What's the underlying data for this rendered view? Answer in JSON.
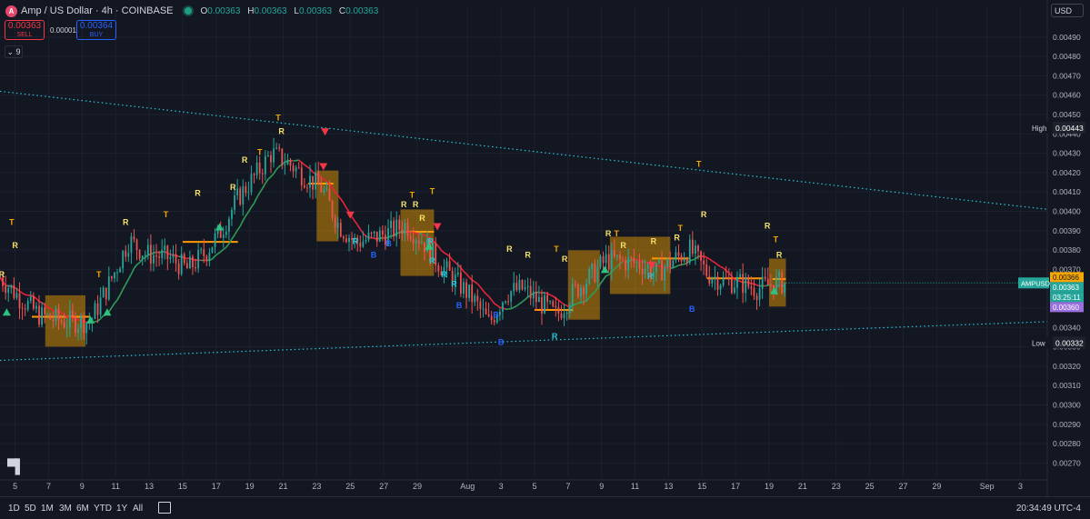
{
  "header": {
    "logo_letter": "A",
    "symbol": "Amp / US Dollar · 4h · COINBASE",
    "ohlc": [
      {
        "label": "O",
        "value": "0.00363"
      },
      {
        "label": "H",
        "value": "0.00363"
      },
      {
        "label": "L",
        "value": "0.00363"
      },
      {
        "label": "C",
        "value": "0.00363"
      }
    ]
  },
  "trade": {
    "sell_price": "0.00363",
    "sell_label": "SELL",
    "spread": "0.00001",
    "buy_price": "0.00364",
    "buy_label": "BUY"
  },
  "indicators_toggle": "9",
  "currency": "USD",
  "timeframes": [
    "1D",
    "5D",
    "1M",
    "3M",
    "6M",
    "YTD",
    "1Y",
    "All"
  ],
  "clock": "20:34:49 UTC-4",
  "chart_data": {
    "type": "candlestick",
    "title": "Amp / US Dollar · 4h · COINBASE",
    "y_ticks": [
      0.0049,
      0.0048,
      0.0047,
      0.0046,
      0.0045,
      0.0044,
      0.0043,
      0.0042,
      0.0041,
      0.004,
      0.0039,
      0.0038,
      0.0037,
      0.0036,
      0.0035,
      0.0034,
      0.0033,
      0.0032,
      0.0031,
      0.003,
      0.0029,
      0.0028,
      0.0027
    ],
    "y_tick_labels": [
      "0.00490",
      "0.00480",
      "0.00470",
      "0.00460",
      "0.00450",
      "0.00440",
      "0.00430",
      "0.00420",
      "0.00410",
      "0.00400",
      "0.00390",
      "0.00380",
      "0.00370",
      "0.00360",
      "0.00350",
      "0.00340",
      "0.00330",
      "0.00320",
      "0.00310",
      "0.00300",
      "0.00290",
      "0.00280",
      "0.00270"
    ],
    "ylim": [
      0.00265,
      0.00496
    ],
    "x_tick_labels": [
      "5",
      "7",
      "9",
      "11",
      "13",
      "15",
      "17",
      "19",
      "21",
      "23",
      "25",
      "27",
      "29",
      "Aug",
      "3",
      "5",
      "7",
      "9",
      "11",
      "13",
      "15",
      "17",
      "19",
      "21",
      "23",
      "25",
      "27",
      "29",
      "Sep",
      "3"
    ],
    "x_tick_days": [
      5,
      7,
      9,
      11,
      13,
      15,
      17,
      19,
      21,
      23,
      25,
      27,
      29,
      32,
      34,
      36,
      38,
      40,
      42,
      44,
      46,
      48,
      50,
      52,
      54,
      56,
      58,
      60,
      63,
      65
    ],
    "xlim_days": [
      4.1,
      66.6
    ],
    "price_path": [
      [
        4.1,
        0.00366
      ],
      [
        5.2,
        0.00356
      ],
      [
        6.5,
        0.00346
      ],
      [
        8.0,
        0.00343
      ],
      [
        9.5,
        0.00343
      ],
      [
        10.8,
        0.00366
      ],
      [
        11.8,
        0.00385
      ],
      [
        12.8,
        0.00378
      ],
      [
        14.2,
        0.00376
      ],
      [
        15.3,
        0.0037
      ],
      [
        16.3,
        0.00378
      ],
      [
        17.3,
        0.0039
      ],
      [
        18.3,
        0.00407
      ],
      [
        19.3,
        0.00418
      ],
      [
        20.3,
        0.0043
      ],
      [
        21.3,
        0.00425
      ],
      [
        22.3,
        0.00418
      ],
      [
        23.3,
        0.00412
      ],
      [
        24.3,
        0.00393
      ],
      [
        25.3,
        0.00384
      ],
      [
        26.3,
        0.00386
      ],
      [
        27.3,
        0.00389
      ],
      [
        28.3,
        0.00393
      ],
      [
        29.3,
        0.00385
      ],
      [
        30.3,
        0.00373
      ],
      [
        31.3,
        0.00364
      ],
      [
        32.3,
        0.00355
      ],
      [
        33.3,
        0.00342
      ],
      [
        34.3,
        0.00358
      ],
      [
        35.3,
        0.0036
      ],
      [
        36.3,
        0.00353
      ],
      [
        37.3,
        0.00346
      ],
      [
        38.3,
        0.00358
      ],
      [
        39.3,
        0.00366
      ],
      [
        40.3,
        0.00375
      ],
      [
        41.3,
        0.00374
      ],
      [
        42.3,
        0.00373
      ],
      [
        43.3,
        0.00368
      ],
      [
        44.3,
        0.00375
      ],
      [
        45.3,
        0.0038
      ],
      [
        46.3,
        0.00368
      ],
      [
        47.3,
        0.00364
      ],
      [
        48.3,
        0.00363
      ],
      [
        49.3,
        0.0036
      ],
      [
        50.3,
        0.00363
      ],
      [
        51.0,
        0.00363
      ]
    ],
    "series": [
      {
        "name": "",
        "role": "upper-trendline",
        "color": "#26c6da",
        "points": [
          [
            4.1,
            0.00462
          ],
          [
            66.6,
            0.00401
          ]
        ]
      },
      {
        "name": "",
        "role": "lower-trendline",
        "color": "#26c6da",
        "points": [
          [
            4.1,
            0.00323
          ],
          [
            66.6,
            0.00343
          ]
        ]
      }
    ],
    "signals": [
      {
        "text": "T",
        "day": 4.8,
        "price": 0.00393,
        "color": "#f7a600"
      },
      {
        "text": "R",
        "day": 4.2,
        "price": 0.00366,
        "color": "#f5e26a"
      },
      {
        "text": "R",
        "day": 5.0,
        "price": 0.00381,
        "color": "#f5e26a"
      },
      {
        "text": "T",
        "day": 10.0,
        "price": 0.00366,
        "color": "#f7a600"
      },
      {
        "text": "R",
        "day": 11.6,
        "price": 0.00393,
        "color": "#f5e26a"
      },
      {
        "text": "T",
        "day": 14.0,
        "price": 0.00397,
        "color": "#f7a600"
      },
      {
        "text": "R",
        "day": 15.9,
        "price": 0.00408,
        "color": "#f5e26a"
      },
      {
        "text": "R",
        "day": 18.0,
        "price": 0.00411,
        "color": "#f5e26a"
      },
      {
        "text": "R",
        "day": 18.7,
        "price": 0.00425,
        "color": "#f5e26a"
      },
      {
        "text": "T",
        "day": 19.6,
        "price": 0.00429,
        "color": "#f7a600"
      },
      {
        "text": "T",
        "day": 20.7,
        "price": 0.00447,
        "color": "#f7a600"
      },
      {
        "text": "R",
        "day": 20.9,
        "price": 0.0044,
        "color": "#f5e26a"
      },
      {
        "text": "R",
        "day": 25.3,
        "price": 0.00383,
        "color": "#26c6da"
      },
      {
        "text": "B",
        "day": 26.4,
        "price": 0.00376,
        "color": "#2962ff"
      },
      {
        "text": "B",
        "day": 27.3,
        "price": 0.00382,
        "color": "#2962ff"
      },
      {
        "text": "T",
        "day": 28.7,
        "price": 0.00407,
        "color": "#f7a600"
      },
      {
        "text": "R",
        "day": 28.2,
        "price": 0.00402,
        "color": "#f5e26a"
      },
      {
        "text": "R",
        "day": 28.9,
        "price": 0.00402,
        "color": "#f5e26a"
      },
      {
        "text": "T",
        "day": 29.9,
        "price": 0.00409,
        "color": "#f7a600"
      },
      {
        "text": "R",
        "day": 29.3,
        "price": 0.00395,
        "color": "#f5e26a"
      },
      {
        "text": "R",
        "day": 29.8,
        "price": 0.00383,
        "color": "#26c6da"
      },
      {
        "text": "R",
        "day": 29.9,
        "price": 0.00373,
        "color": "#26c6da"
      },
      {
        "text": "R",
        "day": 30.6,
        "price": 0.00366,
        "color": "#26c6da"
      },
      {
        "text": "R",
        "day": 31.2,
        "price": 0.00361,
        "color": "#26c6da"
      },
      {
        "text": "B",
        "day": 31.5,
        "price": 0.0035,
        "color": "#2962ff"
      },
      {
        "text": "B",
        "day": 33.7,
        "price": 0.00345,
        "color": "#2962ff"
      },
      {
        "text": "B",
        "day": 34.0,
        "price": 0.00331,
        "color": "#2962ff"
      },
      {
        "text": "R",
        "day": 34.5,
        "price": 0.00379,
        "color": "#f5e26a"
      },
      {
        "text": "R",
        "day": 35.6,
        "price": 0.00376,
        "color": "#f5e26a"
      },
      {
        "text": "T",
        "day": 37.3,
        "price": 0.00379,
        "color": "#f7a600"
      },
      {
        "text": "R",
        "day": 37.8,
        "price": 0.00374,
        "color": "#f5e26a"
      },
      {
        "text": "R",
        "day": 37.2,
        "price": 0.00334,
        "color": "#26c6da"
      },
      {
        "text": "R",
        "day": 40.4,
        "price": 0.00387,
        "color": "#f5e26a"
      },
      {
        "text": "T",
        "day": 40.9,
        "price": 0.00387,
        "color": "#f7a600"
      },
      {
        "text": "R",
        "day": 41.3,
        "price": 0.00381,
        "color": "#f5e26a"
      },
      {
        "text": "R",
        "day": 43.1,
        "price": 0.00383,
        "color": "#f5e26a"
      },
      {
        "text": "R",
        "day": 42.9,
        "price": 0.00365,
        "color": "#26c6da"
      },
      {
        "text": "T",
        "day": 44.7,
        "price": 0.0039,
        "color": "#f7a600"
      },
      {
        "text": "R",
        "day": 44.5,
        "price": 0.00385,
        "color": "#f5e26a"
      },
      {
        "text": "T",
        "day": 45.8,
        "price": 0.00423,
        "color": "#f7a600"
      },
      {
        "text": "R",
        "day": 46.1,
        "price": 0.00397,
        "color": "#f5e26a"
      },
      {
        "text": "B",
        "day": 45.4,
        "price": 0.00348,
        "color": "#2962ff"
      },
      {
        "text": "R",
        "day": 49.9,
        "price": 0.00391,
        "color": "#f5e26a"
      },
      {
        "text": "T",
        "day": 50.4,
        "price": 0.00384,
        "color": "#f7a600"
      },
      {
        "text": "R",
        "day": 50.6,
        "price": 0.00376,
        "color": "#f5e26a"
      }
    ],
    "high_label": "High",
    "high_value": "0.00443",
    "low_label": "Low",
    "low_value": "0.00332",
    "price_labels": [
      {
        "text": "0.00366",
        "value": 0.00366,
        "color": "#f7a600",
        "textcolor": "#131722"
      },
      {
        "text": "0.00363",
        "value": 0.00363,
        "color": "#26a69a",
        "textcolor": "#ffffff"
      },
      {
        "text": "03:25:11",
        "value": 0.003613,
        "color": "#26a69a",
        "textcolor": "#ffffff"
      },
      {
        "text": "0.00360",
        "value": 0.0036,
        "color": "#9c6fe0",
        "textcolor": "#ffffff"
      }
    ],
    "symbol_tag": "AMPUSD"
  }
}
